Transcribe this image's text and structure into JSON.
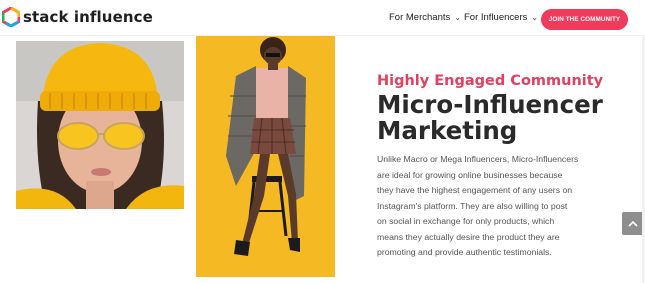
{
  "header": {
    "logo_text": "stack influence",
    "nav": [
      {
        "label": "For Merchants"
      },
      {
        "label": "For Influencers"
      }
    ],
    "cta_label": "JOIN THE COMMUNITY"
  },
  "colors": {
    "brand_pink": "#ef3b5c",
    "kicker_pink": "#e3405f",
    "photo_yellow": "#f5b923"
  },
  "content": {
    "kicker": "Highly Engaged Community",
    "headline": "Micro-Influencer Marketing",
    "body": "Unlike Macro or Mega Influencers, Micro-Influencers are ideal for growing online businesses because they have the highest engagement of any users on Instagram's platform. They are also willing to post on social in exchange for only products, which means they actually desire the product they are promoting and provide authentic testimonials."
  },
  "icons": {
    "logo": "hexagon-logo-icon",
    "dropdown": "chevron-down-icon",
    "back_to_top": "chevron-up-icon"
  }
}
